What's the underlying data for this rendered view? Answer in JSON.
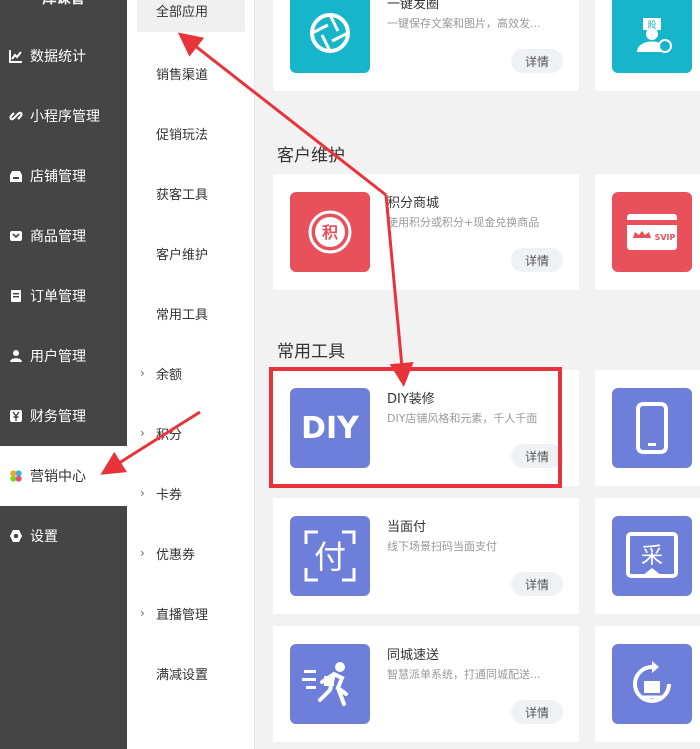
{
  "sidebar": {
    "brand": "库课管",
    "items": [
      {
        "label": "数据统计",
        "icon": "chart-icon"
      },
      {
        "label": "小程序管理",
        "icon": "link-icon"
      },
      {
        "label": "店铺管理",
        "icon": "shop-icon"
      },
      {
        "label": "商品管理",
        "icon": "goods-icon"
      },
      {
        "label": "订单管理",
        "icon": "order-icon"
      },
      {
        "label": "用户管理",
        "icon": "user-icon"
      },
      {
        "label": "财务管理",
        "icon": "finance-icon"
      },
      {
        "label": "营销中心",
        "icon": "marketing-icon"
      },
      {
        "label": "设置",
        "icon": "settings-icon"
      }
    ]
  },
  "submenu": {
    "items": [
      {
        "label": "全部应用"
      },
      {
        "label": "销售渠道"
      },
      {
        "label": "促销玩法"
      },
      {
        "label": "获客工具"
      },
      {
        "label": "客户维护"
      },
      {
        "label": "常用工具"
      },
      {
        "label": "余额",
        "chevron": "›"
      },
      {
        "label": "积分",
        "chevron": "›"
      },
      {
        "label": "卡券",
        "chevron": "›"
      },
      {
        "label": "优惠券",
        "chevron": "›"
      },
      {
        "label": "直播管理",
        "chevron": "›"
      },
      {
        "label": "满减设置"
      }
    ]
  },
  "main": {
    "sections": [
      {
        "title": "客户维护"
      },
      {
        "title": "常用工具"
      }
    ],
    "cards": [
      {
        "name": "一键发圈",
        "desc": "一键保存文案和图片，高效发...",
        "detail": "详情",
        "color": "#17b5c9",
        "icon": "shutter-icon"
      },
      {
        "name": "积分商城",
        "desc": "使用积分或积分+现金兑换商品",
        "detail": "详情",
        "color": "#e8505b",
        "icon": "points-icon",
        "glyph": "积"
      },
      {
        "name": "DIY装修",
        "desc": "DIY店铺风格和元素，千人千面",
        "detail": "详情",
        "color": "#6d7fd9",
        "icon": "diy-icon",
        "glyph": "DIY"
      },
      {
        "name": "当面付",
        "desc": "线下场景扫码当面支付",
        "detail": "详情",
        "color": "#6d7fd9",
        "icon": "pay-icon",
        "glyph": "付"
      },
      {
        "name": "同城速送",
        "desc": "智慧派单系统，打通同城配送...",
        "detail": "详情",
        "color": "#6d7fd9",
        "icon": "delivery-icon"
      }
    ],
    "side_cards": [
      {
        "color": "#17b5c9",
        "icon": "shareholder-icon",
        "glyph": "股"
      },
      {
        "color": "#e8505b",
        "icon": "svip-card-icon",
        "glyph": "SVIP"
      },
      {
        "color": "#6d7fd9",
        "icon": "phone-icon"
      },
      {
        "color": "#6d7fd9",
        "icon": "purchase-icon",
        "glyph": "采"
      },
      {
        "color": "#6d7fd9",
        "icon": "verify-icon"
      }
    ]
  },
  "annotation": {
    "color": "#e9333a"
  }
}
